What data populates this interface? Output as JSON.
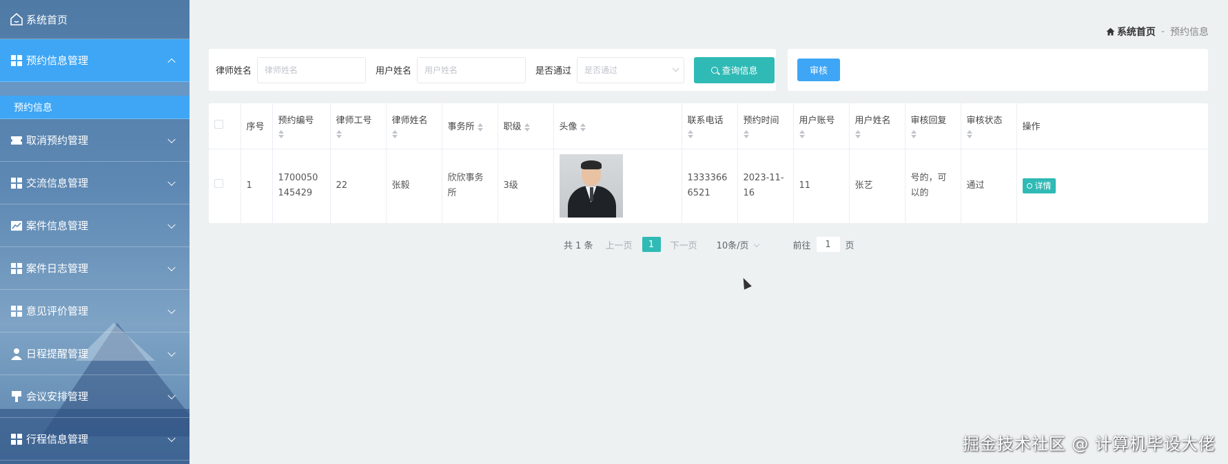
{
  "sidebar": {
    "home": "系统首页",
    "menus": [
      {
        "label": "预约信息管理",
        "icon": "grid-icon",
        "expanded": true
      },
      {
        "label": "取消预约管理",
        "icon": "ticket-icon"
      },
      {
        "label": "交流信息管理",
        "icon": "grid-icon"
      },
      {
        "label": "案件信息管理",
        "icon": "chart-icon"
      },
      {
        "label": "案件日志管理",
        "icon": "grid-icon"
      },
      {
        "label": "意见评价管理",
        "icon": "grid-icon"
      },
      {
        "label": "日程提醒管理",
        "icon": "user-icon"
      },
      {
        "label": "会议安排管理",
        "icon": "stamp-icon"
      },
      {
        "label": "行程信息管理",
        "icon": "grid-icon"
      }
    ],
    "submenu": "预约信息"
  },
  "breadcrumb": {
    "home": "系统首页",
    "separator": "-",
    "current": "预约信息"
  },
  "search": {
    "lawyer_label": "律师姓名",
    "lawyer_placeholder": "律师姓名",
    "user_label": "用户姓名",
    "user_placeholder": "用户姓名",
    "pass_label": "是否通过",
    "pass_placeholder": "是否通过",
    "button": "查询信息"
  },
  "actions": {
    "audit": "审核"
  },
  "table": {
    "headers": [
      "序号",
      "预约编号",
      "律师工号",
      "律师姓名",
      "事务所",
      "职级",
      "头像",
      "联系电话",
      "预约时间",
      "用户账号",
      "用户姓名",
      "审核回复",
      "审核状态",
      "操作"
    ],
    "rows": [
      {
        "index": "1",
        "booking_no": "1700050145429",
        "lawyer_id": "22",
        "lawyer_name": "张毅",
        "firm": "欣欣事务所",
        "rank": "3级",
        "phone": "13333666521",
        "time": "2023-11-16",
        "user_account": "11",
        "user_name": "张艺",
        "reply": "号的，可以的",
        "status": "通过",
        "op": "详情"
      }
    ]
  },
  "pager": {
    "total": "共 1 条",
    "prev": "上一页",
    "page": "1",
    "next": "下一页",
    "size": "10条/页",
    "goto": "前往",
    "goto_value": "1",
    "page_unit": "页"
  },
  "watermark": "掘金技术社区 @ 计算机毕设大佬",
  "colors": {
    "sidebar_active": "#3ea6f5",
    "teal": "#2fbab5",
    "background": "#edf1f2"
  }
}
